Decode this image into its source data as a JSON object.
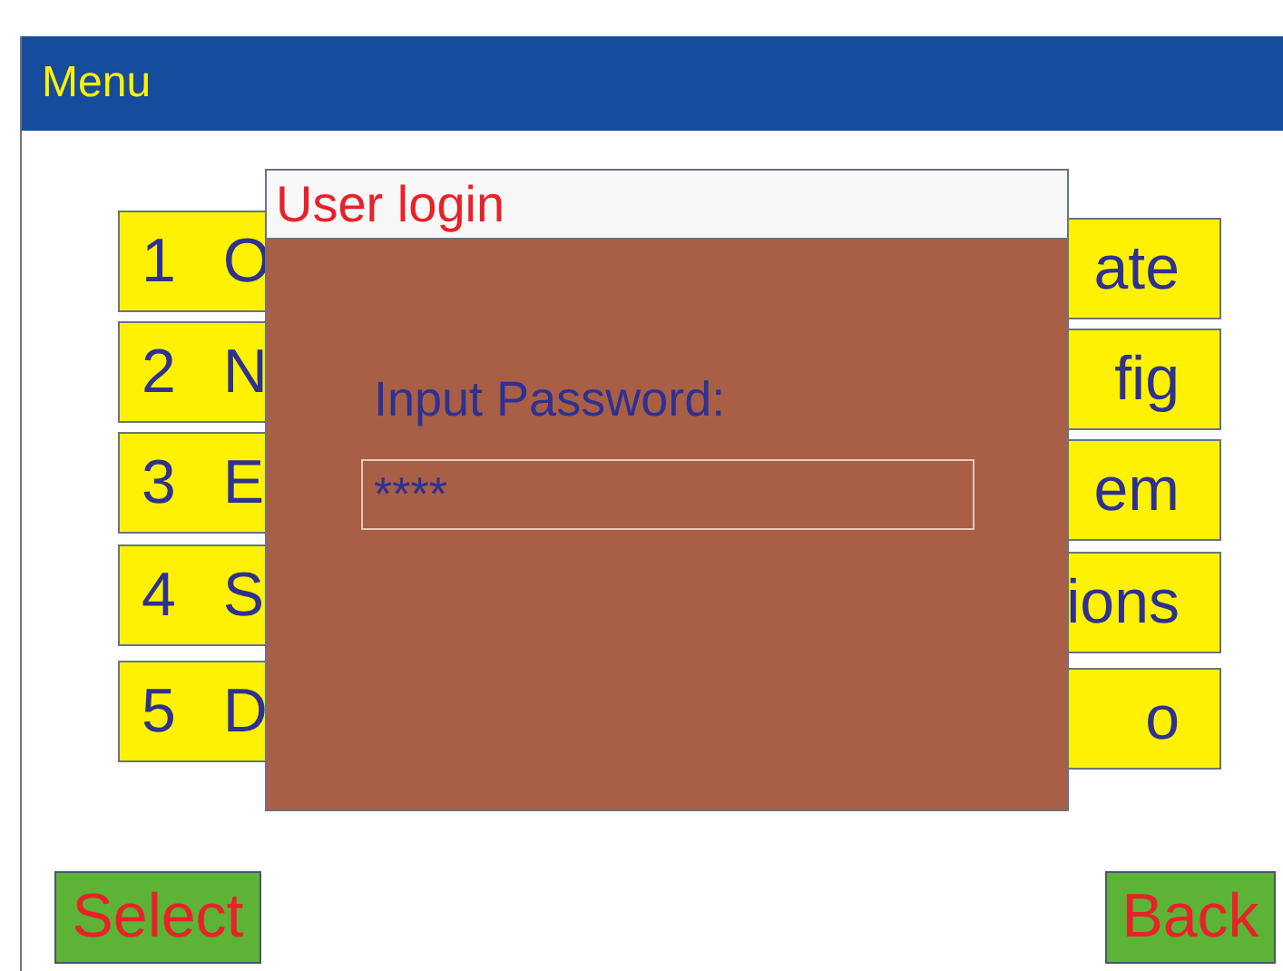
{
  "header": {
    "title": "Menu"
  },
  "menu_left": [
    {
      "number": "1",
      "label": "O"
    },
    {
      "number": "2",
      "label": "N"
    },
    {
      "number": "3",
      "label": "E"
    },
    {
      "number": "4",
      "label": "S"
    },
    {
      "number": "5",
      "label": "D"
    }
  ],
  "menu_right": [
    {
      "label": "ate"
    },
    {
      "label": "fig"
    },
    {
      "label": "em"
    },
    {
      "label": "ions"
    },
    {
      "label": "o"
    }
  ],
  "dialog": {
    "title": "User login",
    "prompt": "Input Password:",
    "password_value": "****"
  },
  "buttons": {
    "select": "Select",
    "back": "Back"
  }
}
